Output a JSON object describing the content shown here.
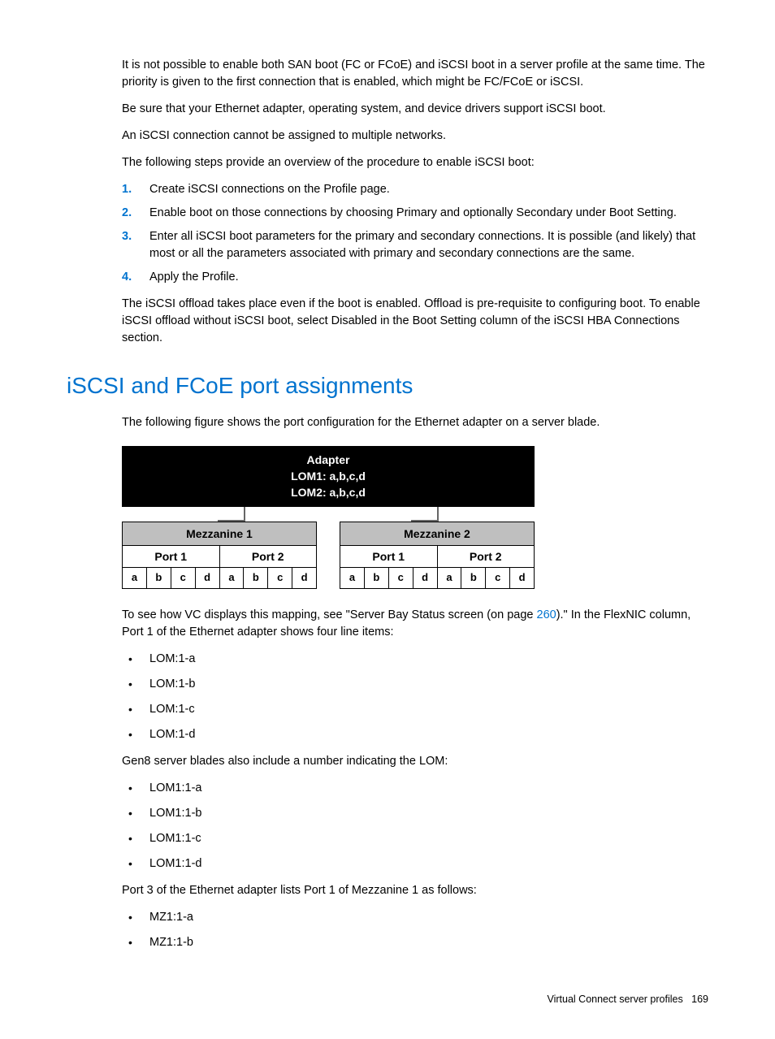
{
  "intro": {
    "p1": "It is not possible to enable both SAN boot (FC or FCoE) and iSCSI boot in a server profile at the same time. The priority is given to the first connection that is enabled, which might be FC/FCoE or iSCSI.",
    "p2": "Be sure that your Ethernet adapter, operating system, and device drivers support iSCSI boot.",
    "p3": "An iSCSI connection cannot be assigned to multiple networks.",
    "p4": "The following steps provide an overview of the procedure to enable iSCSI boot:"
  },
  "steps": [
    "Create iSCSI connections on the Profile page.",
    "Enable boot on those connections by choosing Primary and optionally Secondary under Boot Setting.",
    "Enter all iSCSI boot parameters for the primary and secondary connections. It is possible (and likely) that most or all the parameters associated with primary and secondary connections are the same.",
    "Apply the Profile."
  ],
  "after_steps": "The iSCSI offload takes place even if the boot is enabled. Offload is pre-requisite to configuring boot. To enable iSCSI offload without iSCSI boot, select Disabled in the Boot Setting column of the iSCSI HBA Connections section.",
  "section_title": "iSCSI and FCoE port assignments",
  "section_intro": "The following figure shows the port configuration for the Ethernet adapter on a server blade.",
  "diagram": {
    "adapter_line1": "Adapter",
    "adapter_line2": "LOM1: a,b,c,d",
    "adapter_line3": "LOM2: a,b,c,d",
    "mezz": [
      {
        "title": "Mezzanine 1",
        "ports": [
          {
            "title": "Port 1",
            "slots": [
              "a",
              "b",
              "c",
              "d"
            ]
          },
          {
            "title": "Port 2",
            "slots": [
              "a",
              "b",
              "c",
              "d"
            ]
          }
        ]
      },
      {
        "title": "Mezzanine 2",
        "ports": [
          {
            "title": "Port 1",
            "slots": [
              "a",
              "b",
              "c",
              "d"
            ]
          },
          {
            "title": "Port 2",
            "slots": [
              "a",
              "b",
              "c",
              "d"
            ]
          }
        ]
      }
    ]
  },
  "after_diagram": {
    "pre": "To see how VC displays this mapping, see \"Server Bay Status screen (on page ",
    "link": "260",
    "post": ").\" In the FlexNIC column, Port 1 of the Ethernet adapter shows four line items:"
  },
  "list1": [
    "LOM:1-a",
    "LOM:1-b",
    "LOM:1-c",
    "LOM:1-d"
  ],
  "mid1": "Gen8 server blades also include a number indicating the LOM:",
  "list2": [
    "LOM1:1-a",
    "LOM1:1-b",
    "LOM1:1-c",
    "LOM1:1-d"
  ],
  "mid2": "Port 3 of the Ethernet adapter lists Port 1 of Mezzanine 1 as follows:",
  "list3": [
    "MZ1:1-a",
    "MZ1:1-b"
  ],
  "footer": {
    "section": "Virtual Connect server profiles",
    "page": "169"
  }
}
